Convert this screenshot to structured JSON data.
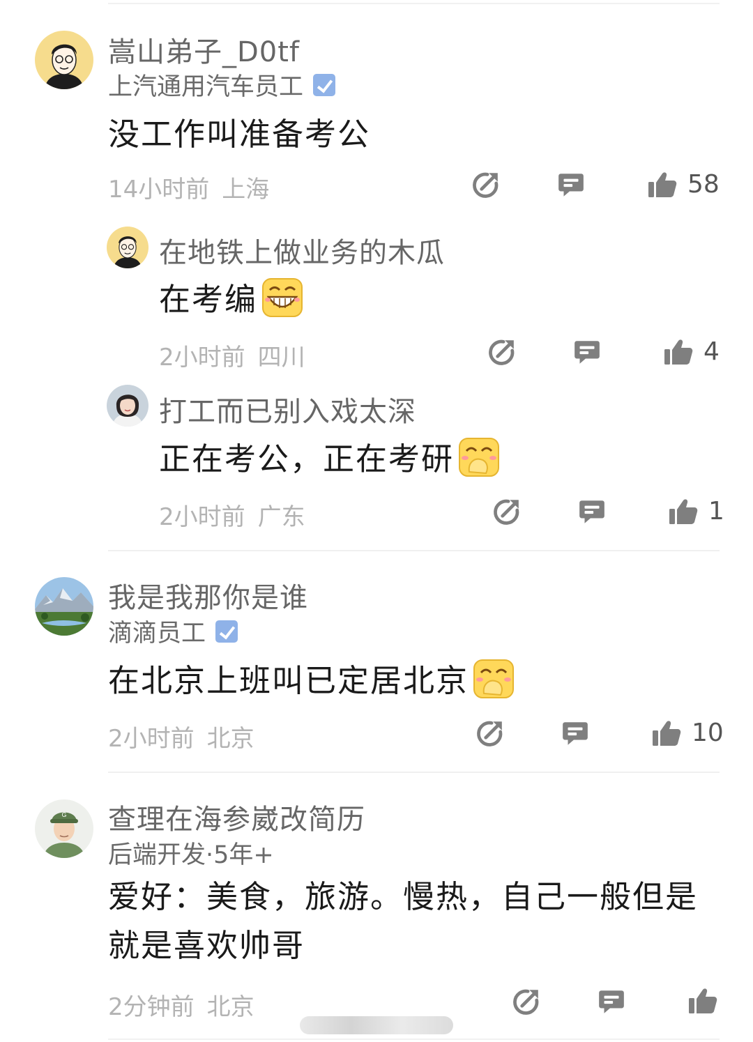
{
  "comments": [
    {
      "username": "嵩山弟子_D0tf",
      "subtitle": "上汽通用汽车员工",
      "verified": true,
      "text": "没工作叫准备考公",
      "time": "14小时前",
      "location": "上海",
      "likes": "58"
    },
    {
      "username": "在地铁上做业务的木瓜",
      "text": "在考编",
      "emoji": "grin-emoji",
      "time": "2小时前",
      "location": "四川",
      "likes": "4"
    },
    {
      "username": "打工而已别入戏太深",
      "text": "正在考公，正在考研",
      "emoji": "cover-mouth-emoji",
      "time": "2小时前",
      "location": "广东",
      "likes": "1"
    },
    {
      "username": "我是我那你是谁",
      "subtitle": "滴滴员工",
      "verified": true,
      "text": "在北京上班叫已定居北京",
      "emoji": "cover-mouth-emoji",
      "time": "2小时前",
      "location": "北京",
      "likes": "10"
    },
    {
      "username": "查理在海参崴改简历",
      "subtitle": "后端开发·5年+",
      "text": "爱好：美食，旅游。慢热，自己一般但是就是喜欢帅哥",
      "time": "2分钟前",
      "location": "北京",
      "likes": ""
    }
  ],
  "icons": {
    "share": "share-icon",
    "reply": "comment-icon",
    "like": "thumbs-up-icon"
  },
  "colors": {
    "username": "#666666",
    "meta": "#b3b3b3",
    "verified_badge": "#8fb2e8",
    "icon": "#7f7f7f"
  }
}
